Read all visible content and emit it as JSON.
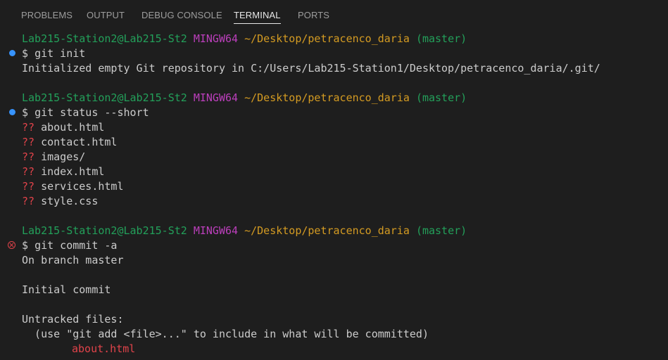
{
  "tabs": [
    {
      "label": "PROBLEMS",
      "active": false
    },
    {
      "label": "OUTPUT",
      "active": false
    },
    {
      "label": "DEBUG CONSOLE",
      "active": false
    },
    {
      "label": "TERMINAL",
      "active": true
    },
    {
      "label": "PORTS",
      "active": false
    }
  ],
  "prompt": {
    "user": "Lab215-Station2@Lab215-St2",
    "system": "MINGW64",
    "path": "~/Desktop/petracenco_daria",
    "branch": "(master)",
    "symbol": "$"
  },
  "commands": [
    {
      "text": "git init",
      "status": "success",
      "output": [
        "Initialized empty Git repository in C:/Users/Lab215-Station1/Desktop/petracenco_daria/.git/"
      ]
    },
    {
      "text": "git status --short",
      "status": "success",
      "status_marker": "??",
      "files": [
        "about.html",
        "contact.html",
        "images/",
        "index.html",
        "services.html",
        "style.css"
      ]
    },
    {
      "text": "git commit -a",
      "status": "error",
      "output": [
        "On branch master",
        "",
        "Initial commit",
        "",
        "Untracked files:",
        "  (use \"git add <file>...\" to include in what will be committed)"
      ],
      "untracked": [
        "about.html"
      ]
    }
  ],
  "colors": {
    "background": "#1e1e1e",
    "text": "#cccccc",
    "user": "#23a05a",
    "system": "#bc3fbc",
    "path": "#d49b22",
    "branch": "#23a05a",
    "untracked": "#e0434a",
    "success_dot": "#3794ff",
    "error_icon": "#e0434a"
  }
}
